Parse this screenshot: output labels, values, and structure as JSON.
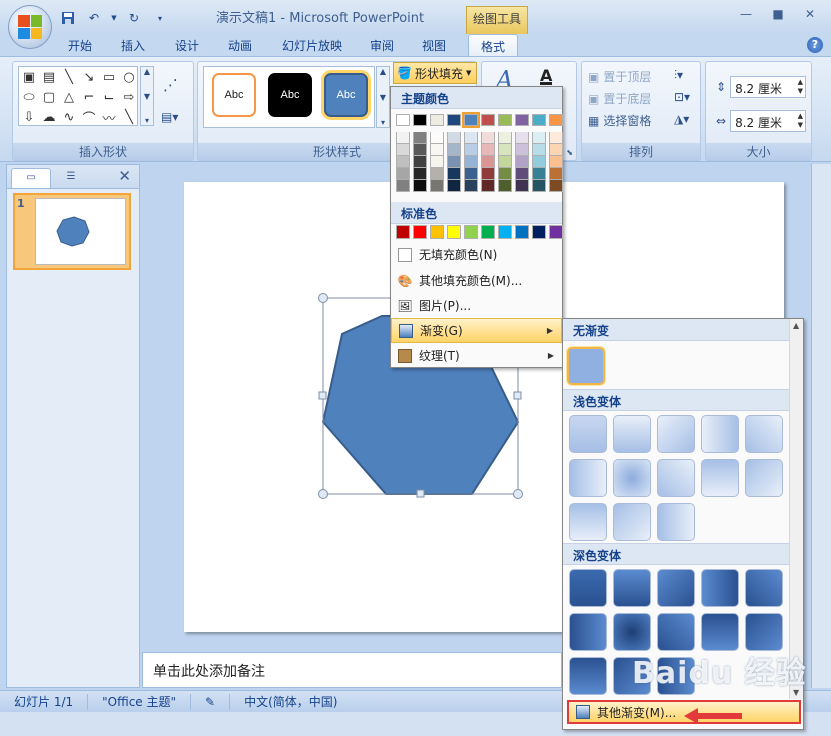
{
  "title_bar": {
    "doc_title": "演示文稿1 - Microsoft PowerPoint",
    "context_tab_title": "绘图工具"
  },
  "tabs": [
    {
      "label": "开始"
    },
    {
      "label": "插入"
    },
    {
      "label": "设计"
    },
    {
      "label": "动画"
    },
    {
      "label": "幻灯片放映"
    },
    {
      "label": "审阅"
    },
    {
      "label": "视图"
    },
    {
      "label": "格式",
      "active": true
    }
  ],
  "ribbon": {
    "insert_shapes_label": "插入形状",
    "shape_styles_label": "形状样式",
    "arrange_label": "排列",
    "size_label": "大小",
    "style_thumb_text": "Abc",
    "fill_button_label": "形状填充",
    "bring_front_label": "置于顶层",
    "send_back_label": "置于底层",
    "selection_pane_label": "选择窗格",
    "height_value": "8.2 厘米",
    "width_value": "8.2 厘米"
  },
  "slides_pane": {
    "slide_number": "1"
  },
  "notes": {
    "placeholder": "单击此处添加备注"
  },
  "status_bar": {
    "slide_count": "幻灯片 1/1",
    "theme": "\"Office 主题\"",
    "language": "中文(简体，中国)"
  },
  "fill_menu": {
    "theme_colors_header": "主题颜色",
    "standard_colors_header": "标准色",
    "no_fill": "无填充颜色(N)",
    "more_colors": "其他填充颜色(M)...",
    "picture": "图片(P)...",
    "gradient": "渐变(G)",
    "texture": "纹理(T)",
    "theme_top_row": [
      "#ffffff",
      "#000000",
      "#eeece1",
      "#1f497d",
      "#4f81bd",
      "#c0504d",
      "#9bbb59",
      "#8064a2",
      "#4bacc6",
      "#f79646"
    ],
    "standard_colors": [
      "#c00000",
      "#ff0000",
      "#ffc000",
      "#ffff00",
      "#92d050",
      "#00b050",
      "#00b0f0",
      "#0070c0",
      "#002060",
      "#7030a0"
    ]
  },
  "gradient_menu": {
    "no_gradient_header": "无渐变",
    "light_variations_header": "浅色变体",
    "dark_variations_header": "深色变体",
    "more_gradients": "其他渐变(M)..."
  },
  "watermark": "Baidu 经验",
  "colors": {
    "shape_fill": "#4f81bd",
    "shape_outline": "#385d8a",
    "accent_orange": "#f2a53b",
    "highlight_red": "#e23a3a"
  }
}
